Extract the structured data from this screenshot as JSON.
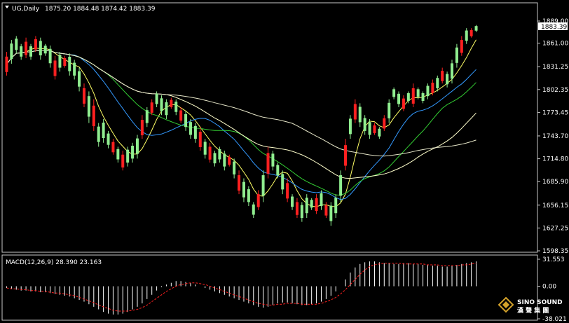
{
  "header": {
    "symbol_label": "UG,Daily",
    "ohlc_text": "1875.20 1884.48 1874.42 1883.39"
  },
  "brand": {
    "name_en": "SINO SOUND",
    "name_cn": "漢 聲 集 團"
  },
  "colors": {
    "background": "#000000",
    "bull": "#ff2020",
    "bear": "#90ee90",
    "axis": "#c8c8c8",
    "ma_fast": "#ffff66",
    "ma_mid": "#3399ff",
    "ma_slow": "#33cc33",
    "ma_long": "#ffffcc",
    "ma_longest": "#e6e6c8",
    "macd_hist": "#ffffff",
    "macd_signal": "#ff2020"
  },
  "chart_data": [
    {
      "type": "candlestick",
      "price_axis_labels": [
        "1889.00",
        "1861.00",
        "1831.25",
        "1802.35",
        "1773.45",
        "1743.70",
        "1714.80",
        "1685.90",
        "1656.15",
        "1627.25",
        "1598.35"
      ],
      "last_price": "1883.39",
      "ylim": [
        1598.35,
        1889.0
      ],
      "moving_averages": [
        "ma_fast",
        "ma_mid",
        "ma_slow",
        "ma_long",
        "ma_longest"
      ],
      "candles": [
        [
          1820,
          1850
        ],
        [
          1835,
          1865
        ],
        [
          1848,
          1870
        ],
        [
          1840,
          1860
        ],
        [
          1842,
          1868
        ],
        [
          1840,
          1860
        ],
        [
          1850,
          1870
        ],
        [
          1840,
          1868
        ],
        [
          1845,
          1860
        ],
        [
          1830,
          1858
        ],
        [
          1815,
          1845
        ],
        [
          1825,
          1850
        ],
        [
          1830,
          1845
        ],
        [
          1820,
          1848
        ],
        [
          1815,
          1840
        ],
        [
          1800,
          1830
        ],
        [
          1780,
          1810
        ],
        [
          1760,
          1800
        ],
        [
          1750,
          1790
        ],
        [
          1730,
          1760
        ],
        [
          1735,
          1765
        ],
        [
          1728,
          1750
        ],
        [
          1720,
          1740
        ],
        [
          1710,
          1730
        ],
        [
          1700,
          1725
        ],
        [
          1705,
          1730
        ],
        [
          1710,
          1735
        ],
        [
          1715,
          1745
        ],
        [
          1740,
          1770
        ],
        [
          1755,
          1780
        ],
        [
          1770,
          1790
        ],
        [
          1780,
          1800
        ],
        [
          1770,
          1795
        ],
        [
          1765,
          1790
        ],
        [
          1778,
          1792
        ],
        [
          1770,
          1790
        ],
        [
          1760,
          1780
        ],
        [
          1750,
          1775
        ],
        [
          1740,
          1765
        ],
        [
          1735,
          1760
        ],
        [
          1725,
          1755
        ],
        [
          1715,
          1740
        ],
        [
          1710,
          1735
        ],
        [
          1705,
          1725
        ],
        [
          1710,
          1730
        ],
        [
          1700,
          1725
        ],
        [
          1705,
          1720
        ],
        [
          1690,
          1715
        ],
        [
          1670,
          1700
        ],
        [
          1660,
          1690
        ],
        [
          1655,
          1680
        ],
        [
          1640,
          1660
        ],
        [
          1650,
          1675
        ],
        [
          1660,
          1700
        ],
        [
          1690,
          1730
        ],
        [
          1700,
          1725
        ],
        [
          1690,
          1710
        ],
        [
          1670,
          1700
        ],
        [
          1660,
          1690
        ],
        [
          1650,
          1670
        ],
        [
          1640,
          1665
        ],
        [
          1635,
          1660
        ],
        [
          1640,
          1670
        ],
        [
          1650,
          1665
        ],
        [
          1645,
          1670
        ],
        [
          1650,
          1675
        ],
        [
          1640,
          1660
        ],
        [
          1630,
          1660
        ],
        [
          1640,
          1670
        ],
        [
          1660,
          1700
        ],
        [
          1700,
          1740
        ],
        [
          1740,
          1770
        ],
        [
          1760,
          1790
        ],
        [
          1755,
          1785
        ],
        [
          1745,
          1770
        ],
        [
          1740,
          1765
        ],
        [
          1745,
          1760
        ],
        [
          1740,
          1755
        ],
        [
          1750,
          1770
        ],
        [
          1760,
          1790
        ],
        [
          1790,
          1805
        ],
        [
          1780,
          1800
        ],
        [
          1775,
          1795
        ],
        [
          1785,
          1800
        ],
        [
          1780,
          1810
        ],
        [
          1790,
          1805
        ],
        [
          1785,
          1800
        ],
        [
          1790,
          1810
        ],
        [
          1795,
          1815
        ],
        [
          1800,
          1820
        ],
        [
          1810,
          1830
        ],
        [
          1805,
          1825
        ],
        [
          1810,
          1840
        ],
        [
          1830,
          1860
        ],
        [
          1845,
          1870
        ],
        [
          1860,
          1880
        ],
        [
          1868,
          1880
        ],
        [
          1875,
          1884
        ]
      ]
    },
    {
      "type": "macd",
      "title": "MACD(12,26,9) 28.390 23.163",
      "axis_labels": [
        "31.553",
        "0.00",
        "-38.021"
      ],
      "ylim": [
        -38.021,
        31.553
      ],
      "histogram": [
        -2,
        -3,
        -4,
        -5,
        -5,
        -6,
        -6,
        -7,
        -7,
        -8,
        -9,
        -10,
        -11,
        -12,
        -14,
        -16,
        -18,
        -21,
        -24,
        -27,
        -30,
        -32,
        -33,
        -33,
        -32,
        -30,
        -27,
        -24,
        -20,
        -15,
        -10,
        -5,
        -1,
        2,
        4,
        6,
        6,
        5,
        4,
        2,
        0,
        -2,
        -4,
        -6,
        -8,
        -10,
        -12,
        -14,
        -16,
        -18,
        -20,
        -22,
        -24,
        -25,
        -24,
        -22,
        -20,
        -19,
        -19,
        -20,
        -21,
        -22,
        -22,
        -21,
        -20,
        -18,
        -15,
        -11,
        -6,
        0,
        8,
        16,
        22,
        26,
        28,
        29,
        29,
        28,
        27,
        27,
        26,
        26,
        27,
        27,
        26,
        26,
        25,
        25,
        24,
        24,
        23,
        23,
        24,
        25,
        26,
        27,
        28,
        29
      ],
      "signal": [
        -2,
        -3,
        -3,
        -4,
        -4,
        -5,
        -5,
        -6,
        -6,
        -7,
        -8,
        -8,
        -9,
        -10,
        -11,
        -13,
        -15,
        -17,
        -19,
        -22,
        -24,
        -26,
        -28,
        -29,
        -29,
        -29,
        -28,
        -27,
        -25,
        -22,
        -18,
        -14,
        -10,
        -6,
        -3,
        0,
        2,
        3,
        4,
        4,
        3,
        2,
        0,
        -2,
        -4,
        -6,
        -8,
        -10,
        -12,
        -14,
        -16,
        -18,
        -20,
        -21,
        -22,
        -22,
        -21,
        -21,
        -20,
        -20,
        -20,
        -21,
        -21,
        -21,
        -21,
        -20,
        -18,
        -16,
        -13,
        -9,
        -4,
        2,
        8,
        14,
        19,
        23,
        25,
        26,
        27,
        27,
        27,
        27,
        26,
        26,
        26,
        26,
        26,
        25,
        25,
        25,
        24,
        24,
        24,
        24,
        25,
        25,
        26,
        27
      ]
    }
  ]
}
